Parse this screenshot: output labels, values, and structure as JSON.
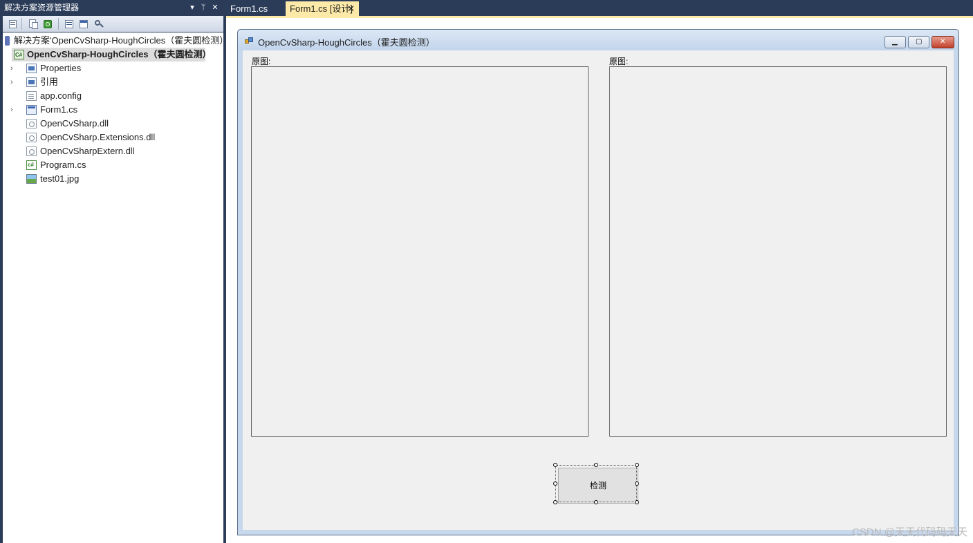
{
  "solution_explorer": {
    "title": "解决方案资源管理器",
    "solution_label": "解决方案'OpenCvSharp-HoughCircles（霍夫圆检测）'",
    "project_label": "OpenCvSharp-HoughCircles（霍夫圆检测）",
    "items": [
      {
        "label": "Properties",
        "icon": "properties-icon",
        "expandable": true
      },
      {
        "label": "引用",
        "icon": "references-icon",
        "expandable": true
      },
      {
        "label": "app.config",
        "icon": "config-file-icon",
        "expandable": false
      },
      {
        "label": "Form1.cs",
        "icon": "form-icon",
        "expandable": true
      },
      {
        "label": "OpenCvSharp.dll",
        "icon": "dll-icon",
        "expandable": false
      },
      {
        "label": "OpenCvSharp.Extensions.dll",
        "icon": "dll-icon",
        "expandable": false
      },
      {
        "label": "OpenCvSharpExtern.dll",
        "icon": "dll-icon",
        "expandable": false
      },
      {
        "label": "Program.cs",
        "icon": "csharp-file-icon",
        "expandable": false
      },
      {
        "label": "test01.jpg",
        "icon": "image-file-icon",
        "expandable": false
      }
    ],
    "glyphs": {
      "dropdown": "▾",
      "pin": "ᛘ",
      "close": "✕",
      "expand": "›"
    }
  },
  "tabs": {
    "inactive": "Form1.cs",
    "active": "Form1.cs [设计]",
    "close_glyph": "✕"
  },
  "designer_form": {
    "title": "OpenCvSharp-HoughCircles（霍夫圆检测）",
    "left_label": "原图:",
    "right_label": "原图:",
    "button_label": "检测",
    "min_glyph": "▁",
    "max_glyph": "▢",
    "close_glyph": "✕"
  },
  "watermark": "CSDN @天天代码码天天",
  "colors": {
    "ide_frame": "#2b3c59",
    "active_tab": "#fde9a8",
    "form_client": "#f0f0f0",
    "close_button": "#c2412b"
  }
}
